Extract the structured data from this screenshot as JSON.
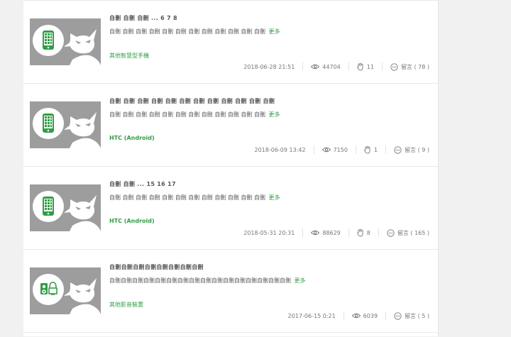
{
  "posts": [
    {
      "title": "自刪 自刪 自刪 ... 6 7 8",
      "excerpt": "自刪 自刪 自刪 自刪 自刪 自刪 自刪 自刪 自刪 自刪 自刪 自刪",
      "more": "更多",
      "category": "其他智慧型手機",
      "date": "2018-06-28 21:51",
      "views": "44704",
      "likes": "11",
      "comments": "留言 ( 78 )",
      "thumb_icon": "phone-icon"
    },
    {
      "title": "自刪 自刪 自刪 自刪 自刪 自刪 自刪 自刪 自刪 自刪 自刪 自刪",
      "excerpt": "自刪 自刪 自刪 自刪 自刪 自刪 自刪 自刪 自刪 自刪 自刪 自刪",
      "more": "更多",
      "category": "HTC (Android)",
      "date": "2018-06-09 13:42",
      "views": "7150",
      "likes": "1",
      "comments": "留言 ( 9 )",
      "thumb_icon": "phone-icon"
    },
    {
      "title": "自刪 自刪 ... 15 16 17",
      "excerpt": "自刪 自刪 自刪 自刪 自刪 自刪 自刪 自刪 自刪 自刪 自刪 自刪",
      "more": "更多",
      "category": "HTC (Android)",
      "date": "2018-05-31 20:31",
      "views": "88629",
      "likes": "8",
      "comments": "留言 ( 165 )",
      "thumb_icon": "phone-icon"
    },
    {
      "title": "自刪自刪自刪自刪自刪自刪自刪自刪",
      "excerpt": "自刪自刪自刪自刪自刪自刪自刪自刪自刪自刪自刪自刪自刪自刪自刪自刪",
      "more": "更多",
      "category": "其他影音裝置",
      "date": "2017-06-15 0:21",
      "views": "6039",
      "likes": "",
      "comments": "留言 ( 5 )",
      "thumb_icon": "av-device-icon"
    }
  ],
  "colors": {
    "accent_green": "#2f9e44",
    "thumb_gray": "#9d9d9d",
    "text": "#555555",
    "meta_text": "#777777"
  }
}
